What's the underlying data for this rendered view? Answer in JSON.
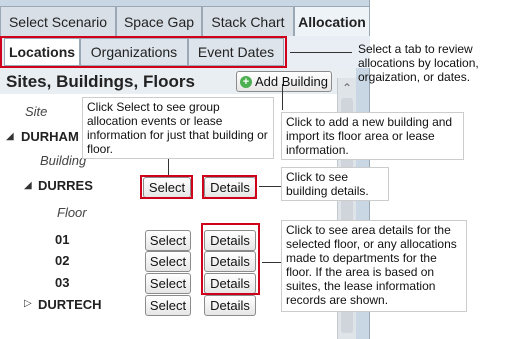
{
  "top_tabs": [
    "Select Scenario",
    "Space Gap",
    "Stack Chart",
    "Allocation"
  ],
  "sub_tabs": [
    "Locations",
    "Organizations",
    "Event Dates"
  ],
  "panel": {
    "title": "Sites, Buildings, Floors",
    "add_building_label": "Add Building"
  },
  "tree": {
    "site_heading": "Site",
    "site1": "DURHAM",
    "building_heading": "Building",
    "building1": "DURRES",
    "floor_heading": "Floor",
    "floors": [
      "01",
      "02",
      "03"
    ],
    "site2": "DURTECH",
    "select_label": "Select",
    "details_label": "Details"
  },
  "callouts": {
    "tabs": "Select a tab to review allocations by location, orgaization, or dates.",
    "select": "Click Select to see group allocation events or lease information for just that building or floor.",
    "add_building": "Click to add a new building and import its floor area or lease information.",
    "building_details": "Click to see building details.",
    "floor_details": "Click to see area details for the selected floor, or any allocations made to departments for the floor. If the area is based on suites, the lease information records are shown."
  },
  "colors": {
    "highlight": "#d0021b",
    "app_background": "#c9d6e3"
  }
}
